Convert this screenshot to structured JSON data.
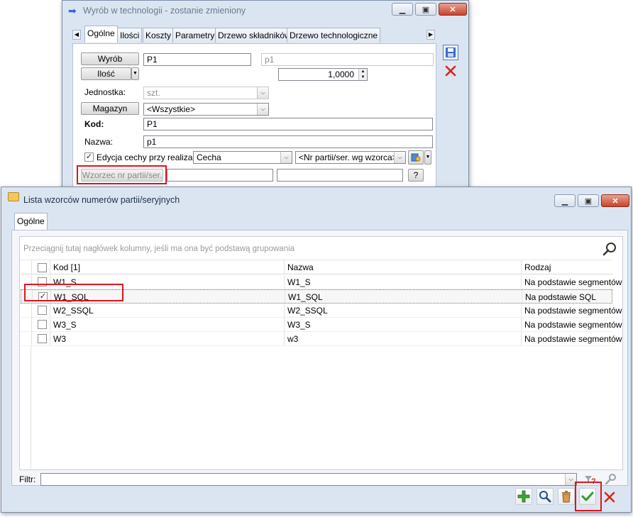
{
  "back_window": {
    "title": "Wyrób w technologii - zostanie zmieniony",
    "tabs": [
      "Ogólne",
      "Ilości",
      "Koszty",
      "Parametry",
      "Drzewo składników",
      "Drzewo technologiczne"
    ],
    "wyrob_label": "Wyrób",
    "wyrob_code": "P1",
    "wyrob_name": "p1",
    "ilosc_label": "Ilość",
    "ilosc_value": "1,0000",
    "jednostka_label": "Jednostka:",
    "jednostka_value": "szt.",
    "magazyn_label": "Magazyn",
    "magazyn_value": "<Wszystkie>",
    "kod_label": "Kod:",
    "kod_value": "P1",
    "nazwa_label": "Nazwa:",
    "nazwa_value": "p1",
    "edycja_label": "Edycja cechy przy realizacji",
    "edycja_checked": true,
    "cecha_value": "Cecha",
    "nr_partii_value": "<Nr partii/ser. wg wzorca>",
    "wzorzec_label": "Wzorzec nr partii/ser.",
    "help_label": "?"
  },
  "front_window": {
    "title": "Lista wzorców numerów partii/seryjnych",
    "tab": "Ogólne",
    "group_hint": "Przeciągnij tutaj nagłówek kolumny, jeśli ma ona być podstawą grupowania",
    "columns": [
      "Kod [1]",
      "Nazwa",
      "Rodzaj"
    ],
    "rows": [
      {
        "kod": "W1_S",
        "nazwa": "W1_S",
        "rodzaj": "Na podstawie segmentów",
        "checked": false
      },
      {
        "kod": "W1_SQL",
        "nazwa": "W1_SQL",
        "rodzaj": "Na podstawie SQL",
        "checked": true
      },
      {
        "kod": "W2_SSQL",
        "nazwa": "W2_SSQL",
        "rodzaj": "Na podstawie segmentów",
        "checked": false
      },
      {
        "kod": "W3_S",
        "nazwa": "W3_S",
        "rodzaj": "Na podstawie segmentów",
        "checked": false
      },
      {
        "kod": "W3",
        "nazwa": "w3",
        "rodzaj": "Na podstawie segmentów",
        "checked": false
      }
    ],
    "filter_label": "Filtr:",
    "filter_value": ""
  },
  "icons": {
    "save": "save-icon",
    "cancel": "close-icon",
    "add": "add-icon",
    "view": "magnifier-icon",
    "delete": "trash-icon",
    "confirm": "checkmark-icon",
    "search": "search-icon"
  },
  "colors": {
    "highlight_red": "#e0141e",
    "confirm_green": "#2e9e2e",
    "add_green": "#3aa635",
    "cancel_red": "#d9251d",
    "window_frame": "#dbe5f1"
  }
}
